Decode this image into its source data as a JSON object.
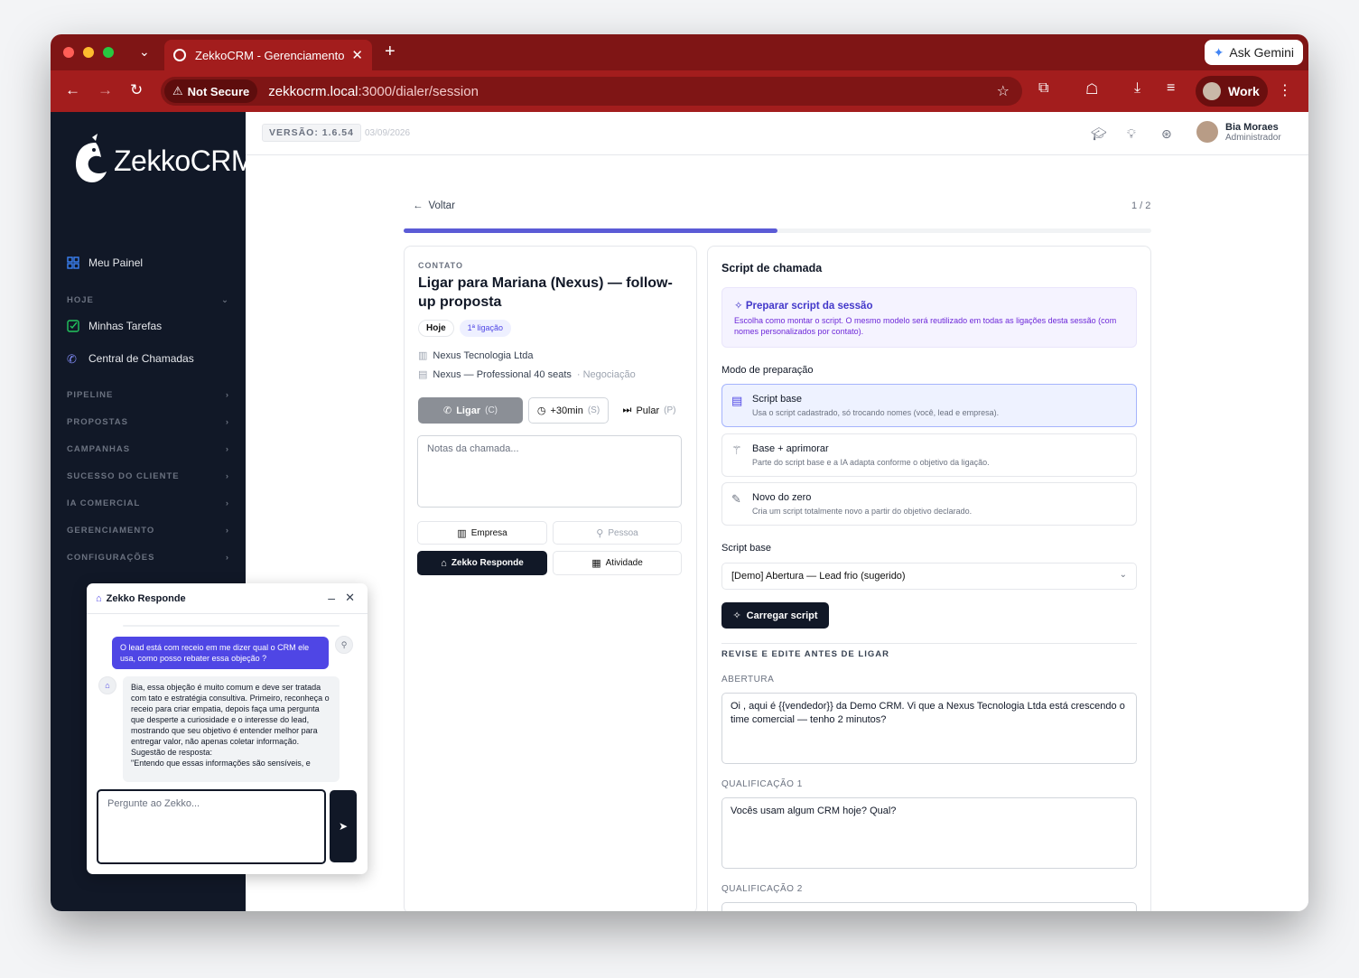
{
  "browser": {
    "tab_title": "ZekkoCRM - Gerenciamento",
    "ask_gemini": "Ask Gemini",
    "not_secure": "Not Secure",
    "url_host": "zekkocrm.local",
    "url_path": ":3000/dialer/session",
    "profile": "Work"
  },
  "sidebar": {
    "logo": "ZekkoCRM",
    "meu_painel": "Meu Painel",
    "hoje": "HOJE",
    "minhas_tarefas": "Minhas Tarefas",
    "central_chamadas": "Central de Chamadas",
    "sections": [
      "PIPELINE",
      "PROPOSTAS",
      "CAMPANHAS",
      "SUCESSO DO CLIENTE",
      "IA COMERCIAL",
      "GERENCIAMENTO",
      "CONFIGURAÇÕES"
    ]
  },
  "header": {
    "version": "VERSÃO: 1.6.54",
    "date": "03/09/2026",
    "user_name": "Bia Moraes",
    "user_role": "Administrador"
  },
  "session": {
    "back": "Voltar",
    "counter": "1 / 2",
    "progress": 0.5
  },
  "contact": {
    "eyebrow": "CONTATO",
    "title": "Ligar para Mariana (Nexus) — follow-up proposta",
    "pill_today": "Hoje",
    "pill_call": "1ª ligação",
    "company": "Nexus Tecnologia Ltda",
    "deal": "Nexus — Professional 40 seats",
    "deal_stage": "· Negociação",
    "btn_call": "Ligar",
    "btn_call_key": "(C)",
    "btn_snooze": "+30min",
    "btn_snooze_key": "(S)",
    "btn_skip": "Pular",
    "btn_skip_key": "(P)",
    "notes_placeholder": "Notas da chamada...",
    "tab_empresa": "Empresa",
    "tab_pessoa": "Pessoa",
    "tab_zekko": "Zekko Responde",
    "tab_atividade": "Atividade"
  },
  "script": {
    "title": "Script de chamada",
    "prep_title": "Preparar script da sessão",
    "prep_desc": "Escolha como montar o script. O mesmo modelo será reutilizado em todas as ligações desta sessão (com nomes personalizados por contato).",
    "mode_label": "Modo de preparação",
    "options": [
      {
        "title": "Script base",
        "desc": "Usa o script cadastrado, só trocando nomes (você, lead e empresa)."
      },
      {
        "title": "Base + aprimorar",
        "desc": "Parte do script base e a IA adapta conforme o objetivo da ligação."
      },
      {
        "title": "Novo do zero",
        "desc": "Cria um script totalmente novo a partir do objetivo declarado."
      }
    ],
    "base_label": "Script base",
    "base_value": "[Demo] Abertura — Lead frio (sugerido)",
    "load_btn": "Carregar script",
    "review": "REVISE E EDITE ANTES DE LIGAR",
    "abertura_label": "ABERTURA",
    "abertura_text": "Oi , aqui é {{vendedor}} da Demo CRM. Vi que a Nexus Tecnologia Ltda está crescendo o time comercial — tenho 2 minutos?",
    "q1_label": "QUALIFICAÇÃO 1",
    "q1_text": "Vocês usam algum CRM hoje? Qual?",
    "q2_label": "QUALIFICAÇÃO 2"
  },
  "chat": {
    "title": "Zekko Responde",
    "user_msg": "O lead está com receio em me dizer qual o CRM ele usa, como posso rebater essa objeção ?",
    "bot_msg": "Bia, essa objeção é muito comum e deve ser tratada com tato e estratégia consultiva. Primeiro, reconheça o receio para criar empatia, depois faça uma pergunta que desperte a curiosidade e o interesse do lead, mostrando que seu objetivo é entender melhor para entregar valor, não apenas coletar informação.\nSugestão de resposta:\n\"Entendo que essas informações são sensíveis, e",
    "input_placeholder": "Pergunte ao Zekko..."
  }
}
